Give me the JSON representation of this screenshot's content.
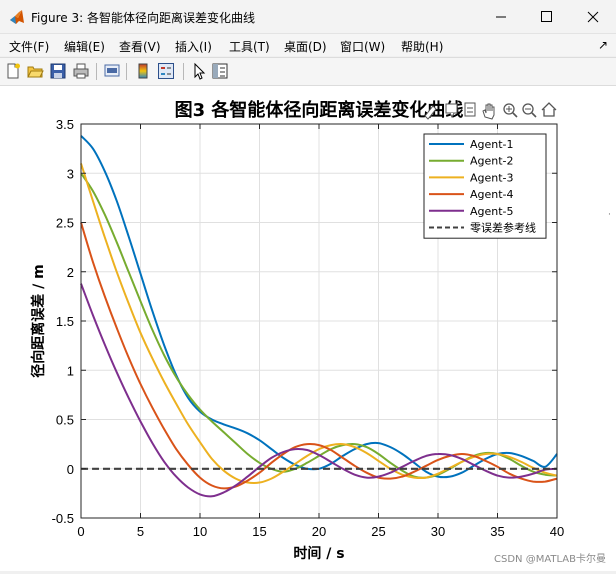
{
  "window": {
    "title": "Figure 3: 各智能体径向距离误差变化曲线",
    "controls": [
      "minimize",
      "maximize",
      "close"
    ]
  },
  "menu": {
    "items": [
      "文件(F)",
      "编辑(E)",
      "查看(V)",
      "插入(I)",
      "工具(T)",
      "桌面(D)",
      "窗口(W)",
      "帮助(H)"
    ],
    "overflow": "↗"
  },
  "toolbar": {
    "icons": [
      "new-figure-icon",
      "open-file-icon",
      "save-icon",
      "print-icon",
      "print-preview-icon",
      "colorbar-icon",
      "legend-icon",
      "pointer-icon",
      "property-editor-icon"
    ]
  },
  "axes_toolbar": {
    "icons": [
      "brush-icon",
      "data-tip-icon",
      "restore-view-icon",
      "pan-icon",
      "zoom-in-icon",
      "zoom-out-icon",
      "home-icon"
    ]
  },
  "watermark": "CSDN @MATLAB卡尔曼",
  "colors": {
    "agent1": "#0072bd",
    "agent2": "#77ac30",
    "agent3": "#edb120",
    "agent4": "#d95319",
    "agent5": "#7e2f8e",
    "reference": "#404040"
  },
  "chart_data": {
    "type": "line",
    "title": "图3 各智能体径向距离误差变化曲线",
    "xlabel": "时间 / s",
    "ylabel": "径向距离误差 / m",
    "xlim": [
      0,
      40
    ],
    "ylim": [
      -0.5,
      3.5
    ],
    "xticks": [
      "0",
      "5",
      "10",
      "15",
      "20",
      "25",
      "30",
      "35",
      "40"
    ],
    "yticks": [
      "-0.5",
      "0",
      "0.5",
      "1",
      "1.5",
      "2",
      "2.5",
      "3",
      "3.5"
    ],
    "grid": true,
    "legend_location": "top-right",
    "x": [
      0,
      1,
      2,
      3,
      4,
      5,
      6,
      7,
      8,
      9,
      10,
      11,
      12,
      13,
      14,
      15,
      16,
      17,
      18,
      19,
      20,
      21,
      22,
      23,
      24,
      25,
      26,
      27,
      28,
      29,
      30,
      31,
      32,
      33,
      34,
      35,
      36,
      37,
      38,
      39,
      40
    ],
    "series": [
      {
        "name": "Agent-1",
        "color": "#0072bd",
        "values": [
          3.38,
          3.25,
          3.02,
          2.72,
          2.36,
          1.98,
          1.6,
          1.25,
          0.95,
          0.72,
          0.58,
          0.5,
          0.45,
          0.41,
          0.36,
          0.29,
          0.2,
          0.11,
          0.04,
          0.0,
          0.0,
          0.05,
          0.13,
          0.2,
          0.25,
          0.26,
          0.22,
          0.15,
          0.06,
          -0.03,
          -0.08,
          -0.08,
          -0.04,
          0.03,
          0.1,
          0.15,
          0.16,
          0.13,
          0.08,
          0.02,
          0.15
        ]
      },
      {
        "name": "Agent-2",
        "color": "#77ac30",
        "values": [
          3.0,
          2.82,
          2.58,
          2.3,
          2.0,
          1.7,
          1.41,
          1.15,
          0.93,
          0.75,
          0.6,
          0.48,
          0.37,
          0.26,
          0.15,
          0.06,
          0.0,
          -0.03,
          0.0,
          0.06,
          0.13,
          0.2,
          0.24,
          0.25,
          0.22,
          0.15,
          0.06,
          -0.02,
          -0.08,
          -0.09,
          -0.06,
          0.0,
          0.07,
          0.13,
          0.16,
          0.15,
          0.1,
          0.03,
          -0.03,
          -0.06,
          -0.07
        ]
      },
      {
        "name": "Agent-3",
        "color": "#edb120",
        "values": [
          3.1,
          2.72,
          2.35,
          2.0,
          1.68,
          1.38,
          1.12,
          0.88,
          0.66,
          0.45,
          0.27,
          0.1,
          -0.02,
          -0.1,
          -0.14,
          -0.14,
          -0.1,
          -0.03,
          0.05,
          0.13,
          0.2,
          0.24,
          0.25,
          0.22,
          0.16,
          0.08,
          0.0,
          -0.06,
          -0.09,
          -0.09,
          -0.05,
          0.01,
          0.07,
          0.12,
          0.15,
          0.15,
          0.12,
          0.07,
          0.01,
          -0.04,
          -0.07
        ]
      },
      {
        "name": "Agent-4",
        "color": "#d95319",
        "values": [
          2.5,
          2.1,
          1.75,
          1.43,
          1.13,
          0.86,
          0.62,
          0.4,
          0.2,
          0.04,
          -0.09,
          -0.17,
          -0.2,
          -0.18,
          -0.12,
          -0.04,
          0.06,
          0.15,
          0.22,
          0.25,
          0.24,
          0.19,
          0.11,
          0.03,
          -0.04,
          -0.09,
          -0.1,
          -0.08,
          -0.03,
          0.03,
          0.09,
          0.13,
          0.15,
          0.13,
          0.08,
          0.02,
          -0.05,
          -0.1,
          -0.13,
          -0.13,
          -0.1
        ]
      },
      {
        "name": "Agent-5",
        "color": "#7e2f8e",
        "values": [
          1.88,
          1.56,
          1.26,
          0.98,
          0.72,
          0.48,
          0.26,
          0.07,
          -0.08,
          -0.19,
          -0.26,
          -0.28,
          -0.24,
          -0.17,
          -0.08,
          0.02,
          0.11,
          0.17,
          0.2,
          0.19,
          0.14,
          0.07,
          0.0,
          -0.06,
          -0.09,
          -0.08,
          -0.04,
          0.02,
          0.08,
          0.13,
          0.15,
          0.14,
          0.1,
          0.04,
          -0.02,
          -0.07,
          -0.09,
          -0.08,
          -0.05,
          -0.01,
          0.0
        ]
      },
      {
        "name": "零误差参考线",
        "color": "#404040",
        "dashed": true,
        "values": [
          0,
          0,
          0,
          0,
          0,
          0,
          0,
          0,
          0,
          0,
          0,
          0,
          0,
          0,
          0,
          0,
          0,
          0,
          0,
          0,
          0,
          0,
          0,
          0,
          0,
          0,
          0,
          0,
          0,
          0,
          0,
          0,
          0,
          0,
          0,
          0,
          0,
          0,
          0,
          0,
          0
        ]
      }
    ]
  }
}
